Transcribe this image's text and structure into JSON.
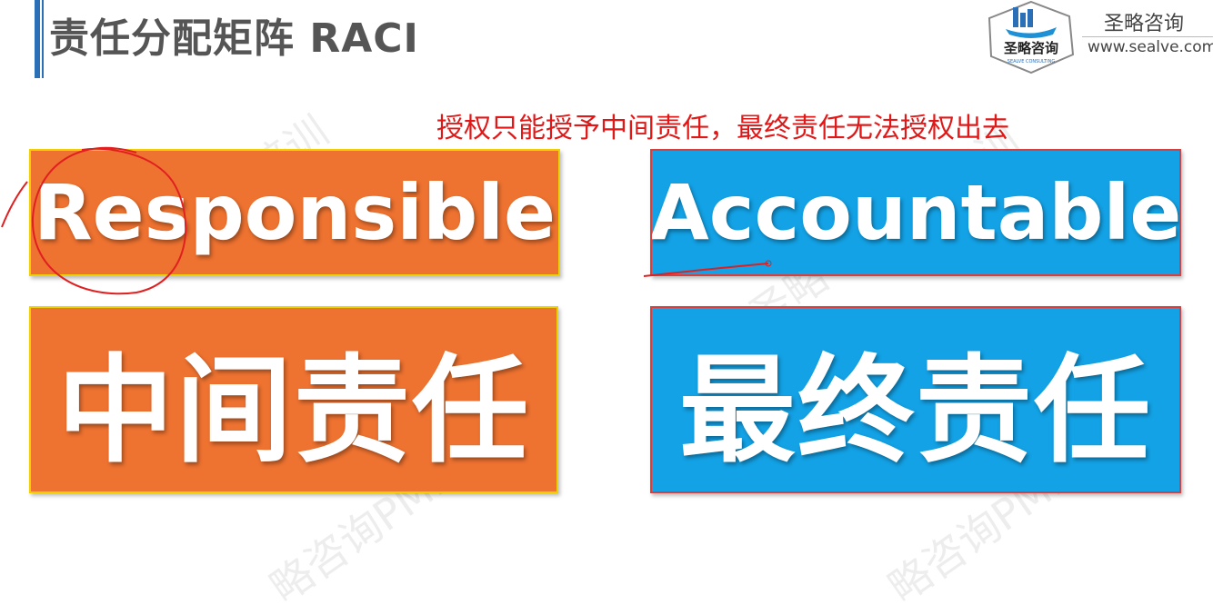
{
  "header": {
    "title": "责任分配矩阵 RACI",
    "brand_name": "圣略咨询",
    "brand_url": "www.sealve.com",
    "logo_text": "圣略咨询",
    "logo_subtext": "SEALVE CONSULTING"
  },
  "note": "授权只能授予中间责任，最终责任无法授权出去",
  "cards": {
    "responsible_en": "Responsible",
    "accountable_en": "Accountable",
    "responsible_cn": "中间责任",
    "accountable_cn": "最终责任"
  },
  "watermarks": [
    "培训",
    "培训",
    "圣略",
    "略咨询PMP",
    "略咨询PMP"
  ],
  "colors": {
    "orange": "#ee7230",
    "blue": "#13a2e6",
    "accent": "#2b6fb6",
    "note_red": "#e11818"
  }
}
